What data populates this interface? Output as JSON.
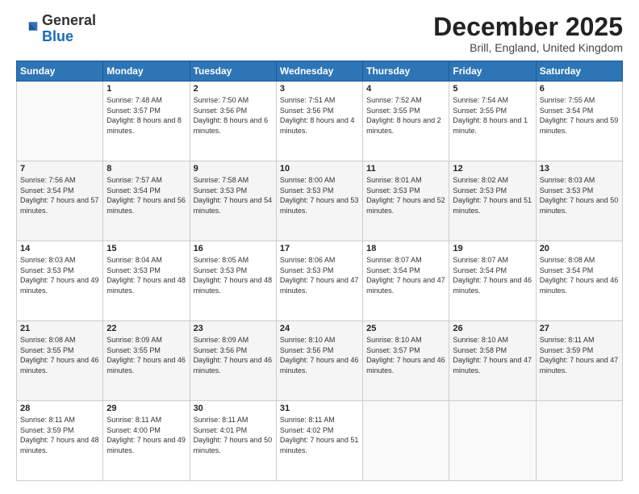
{
  "logo": {
    "general": "General",
    "blue": "Blue"
  },
  "header": {
    "month": "December 2025",
    "location": "Brill, England, United Kingdom"
  },
  "days_of_week": [
    "Sunday",
    "Monday",
    "Tuesday",
    "Wednesday",
    "Thursday",
    "Friday",
    "Saturday"
  ],
  "weeks": [
    [
      {
        "day": "",
        "info": ""
      },
      {
        "day": "1",
        "info": "Sunrise: 7:48 AM\nSunset: 3:57 PM\nDaylight: 8 hours\nand 8 minutes."
      },
      {
        "day": "2",
        "info": "Sunrise: 7:50 AM\nSunset: 3:56 PM\nDaylight: 8 hours\nand 6 minutes."
      },
      {
        "day": "3",
        "info": "Sunrise: 7:51 AM\nSunset: 3:56 PM\nDaylight: 8 hours\nand 4 minutes."
      },
      {
        "day": "4",
        "info": "Sunrise: 7:52 AM\nSunset: 3:55 PM\nDaylight: 8 hours\nand 2 minutes."
      },
      {
        "day": "5",
        "info": "Sunrise: 7:54 AM\nSunset: 3:55 PM\nDaylight: 8 hours\nand 1 minute."
      },
      {
        "day": "6",
        "info": "Sunrise: 7:55 AM\nSunset: 3:54 PM\nDaylight: 7 hours\nand 59 minutes."
      }
    ],
    [
      {
        "day": "7",
        "info": "Sunrise: 7:56 AM\nSunset: 3:54 PM\nDaylight: 7 hours\nand 57 minutes."
      },
      {
        "day": "8",
        "info": "Sunrise: 7:57 AM\nSunset: 3:54 PM\nDaylight: 7 hours\nand 56 minutes."
      },
      {
        "day": "9",
        "info": "Sunrise: 7:58 AM\nSunset: 3:53 PM\nDaylight: 7 hours\nand 54 minutes."
      },
      {
        "day": "10",
        "info": "Sunrise: 8:00 AM\nSunset: 3:53 PM\nDaylight: 7 hours\nand 53 minutes."
      },
      {
        "day": "11",
        "info": "Sunrise: 8:01 AM\nSunset: 3:53 PM\nDaylight: 7 hours\nand 52 minutes."
      },
      {
        "day": "12",
        "info": "Sunrise: 8:02 AM\nSunset: 3:53 PM\nDaylight: 7 hours\nand 51 minutes."
      },
      {
        "day": "13",
        "info": "Sunrise: 8:03 AM\nSunset: 3:53 PM\nDaylight: 7 hours\nand 50 minutes."
      }
    ],
    [
      {
        "day": "14",
        "info": "Sunrise: 8:03 AM\nSunset: 3:53 PM\nDaylight: 7 hours\nand 49 minutes."
      },
      {
        "day": "15",
        "info": "Sunrise: 8:04 AM\nSunset: 3:53 PM\nDaylight: 7 hours\nand 48 minutes."
      },
      {
        "day": "16",
        "info": "Sunrise: 8:05 AM\nSunset: 3:53 PM\nDaylight: 7 hours\nand 48 minutes."
      },
      {
        "day": "17",
        "info": "Sunrise: 8:06 AM\nSunset: 3:53 PM\nDaylight: 7 hours\nand 47 minutes."
      },
      {
        "day": "18",
        "info": "Sunrise: 8:07 AM\nSunset: 3:54 PM\nDaylight: 7 hours\nand 47 minutes."
      },
      {
        "day": "19",
        "info": "Sunrise: 8:07 AM\nSunset: 3:54 PM\nDaylight: 7 hours\nand 46 minutes."
      },
      {
        "day": "20",
        "info": "Sunrise: 8:08 AM\nSunset: 3:54 PM\nDaylight: 7 hours\nand 46 minutes."
      }
    ],
    [
      {
        "day": "21",
        "info": "Sunrise: 8:08 AM\nSunset: 3:55 PM\nDaylight: 7 hours\nand 46 minutes."
      },
      {
        "day": "22",
        "info": "Sunrise: 8:09 AM\nSunset: 3:55 PM\nDaylight: 7 hours\nand 46 minutes."
      },
      {
        "day": "23",
        "info": "Sunrise: 8:09 AM\nSunset: 3:56 PM\nDaylight: 7 hours\nand 46 minutes."
      },
      {
        "day": "24",
        "info": "Sunrise: 8:10 AM\nSunset: 3:56 PM\nDaylight: 7 hours\nand 46 minutes."
      },
      {
        "day": "25",
        "info": "Sunrise: 8:10 AM\nSunset: 3:57 PM\nDaylight: 7 hours\nand 46 minutes."
      },
      {
        "day": "26",
        "info": "Sunrise: 8:10 AM\nSunset: 3:58 PM\nDaylight: 7 hours\nand 47 minutes."
      },
      {
        "day": "27",
        "info": "Sunrise: 8:11 AM\nSunset: 3:59 PM\nDaylight: 7 hours\nand 47 minutes."
      }
    ],
    [
      {
        "day": "28",
        "info": "Sunrise: 8:11 AM\nSunset: 3:59 PM\nDaylight: 7 hours\nand 48 minutes."
      },
      {
        "day": "29",
        "info": "Sunrise: 8:11 AM\nSunset: 4:00 PM\nDaylight: 7 hours\nand 49 minutes."
      },
      {
        "day": "30",
        "info": "Sunrise: 8:11 AM\nSunset: 4:01 PM\nDaylight: 7 hours\nand 50 minutes."
      },
      {
        "day": "31",
        "info": "Sunrise: 8:11 AM\nSunset: 4:02 PM\nDaylight: 7 hours\nand 51 minutes."
      },
      {
        "day": "",
        "info": ""
      },
      {
        "day": "",
        "info": ""
      },
      {
        "day": "",
        "info": ""
      }
    ]
  ]
}
